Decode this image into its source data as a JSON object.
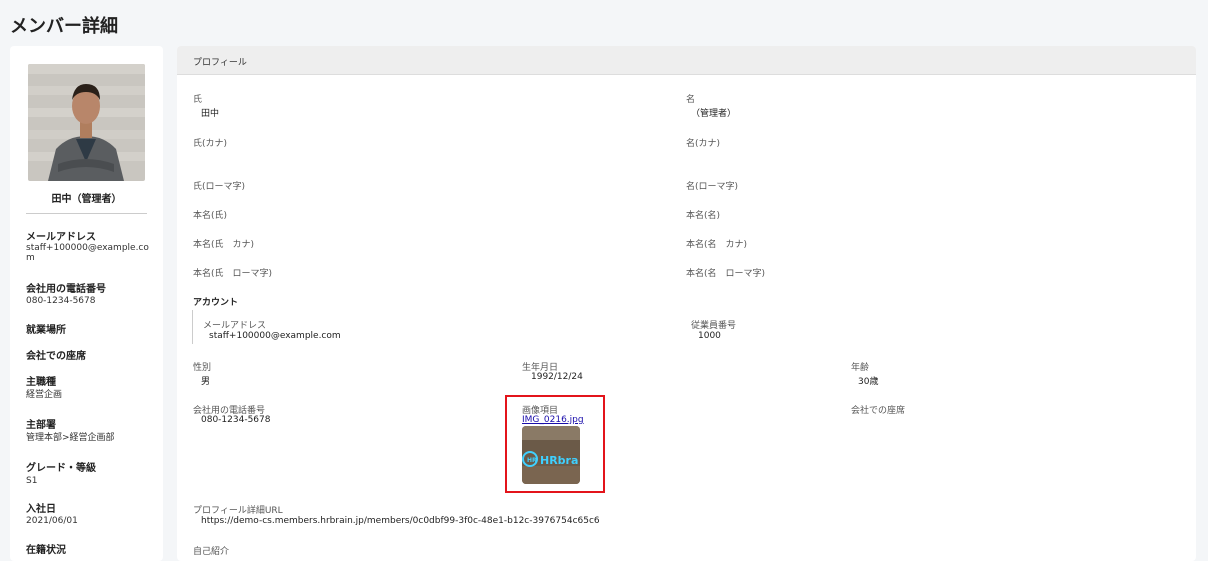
{
  "page": {
    "title": "メンバー詳細"
  },
  "sidebar": {
    "name": "田中（管理者）",
    "fields": [
      {
        "label": "メールアドレス",
        "value": "staff+100000@example.com"
      },
      {
        "label": "会社用の電話番号",
        "value": "080-1234-5678"
      },
      {
        "label": "就業場所",
        "value": ""
      },
      {
        "label": "会社での座席",
        "value": ""
      },
      {
        "label": "主職種",
        "value": "経営企画"
      },
      {
        "label": "主部署",
        "value": "管理本部>経営企画部"
      },
      {
        "label": "グレード・等級",
        "value": "S1"
      },
      {
        "label": "入社日",
        "value": "2021/06/01"
      },
      {
        "label": "在籍状況",
        "value": ""
      }
    ]
  },
  "profile": {
    "header": "プロフィール",
    "last_name": {
      "label": "氏",
      "value": "田中"
    },
    "first_name": {
      "label": "名",
      "value": "（管理者）"
    },
    "last_name_kana": {
      "label": "氏(カナ)"
    },
    "first_name_kana": {
      "label": "名(カナ)"
    },
    "last_name_roman": {
      "label": "氏(ローマ字)"
    },
    "first_name_roman": {
      "label": "名(ローマ字)"
    },
    "real_last_name": {
      "label": "本名(氏)"
    },
    "real_first_name": {
      "label": "本名(名)"
    },
    "real_last_name_kana": {
      "label": "本名(氏　カナ)"
    },
    "real_first_name_kana": {
      "label": "本名(名　カナ)"
    },
    "real_last_name_roman": {
      "label": "本名(氏　ローマ字)"
    },
    "real_first_name_roman": {
      "label": "本名(名　ローマ字)"
    },
    "account": {
      "heading": "アカウント",
      "email": {
        "label": "メールアドレス",
        "value": "staff+100000@example.com"
      },
      "employee_no": {
        "label": "従業員番号",
        "value": "1000"
      }
    },
    "gender": {
      "label": "性別",
      "value": "男"
    },
    "birthday": {
      "label": "生年月日",
      "value": "1992/12/24"
    },
    "age": {
      "label": "年齢",
      "value": "30歳"
    },
    "phone": {
      "label": "会社用の電話番号",
      "value": "080-1234-5678"
    },
    "image_item": {
      "label": "画像項目",
      "file": "IMG_0216.jpg"
    },
    "seat": {
      "label": "会社での座席"
    },
    "profile_url": {
      "label": "プロフィール詳細URL",
      "value": "https://demo-cs.members.hrbrain.jp/members/0c0dbf99-3f0c-48e1-b12c-3976754c65c6"
    },
    "self_intro": {
      "label": "自己紹介"
    }
  },
  "colors": {
    "highlight": "#e3141b",
    "link": "#1a0dab"
  },
  "images": {
    "avatar": "person-photo",
    "thumbnail": "hrbrain-logo-photo"
  }
}
